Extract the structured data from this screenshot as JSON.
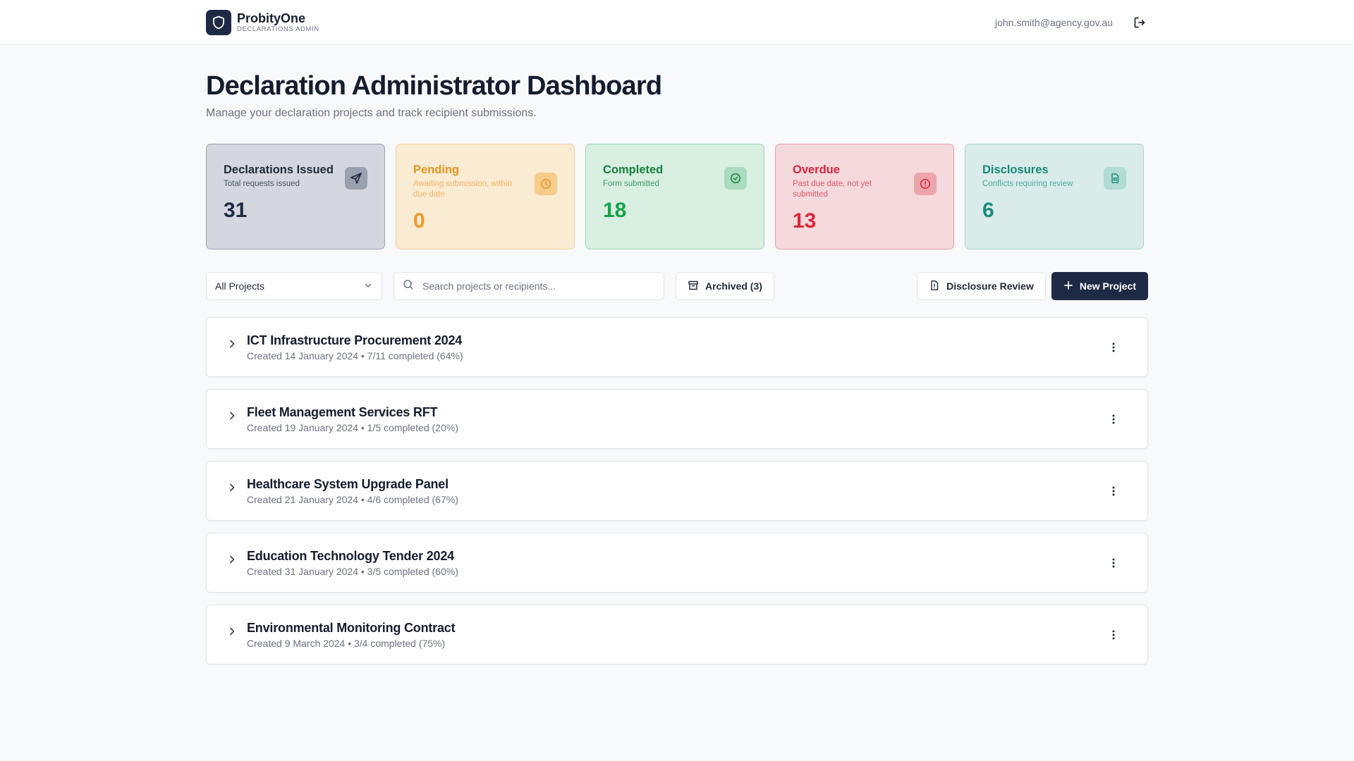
{
  "header": {
    "brand_name": "ProbityOne",
    "brand_sub": "DECLARATIONS ADMIN",
    "user_email": "john.smith@agency.gov.au",
    "logo_icon": "shield-icon",
    "logout_icon": "logout-icon"
  },
  "page": {
    "title": "Declaration Administrator Dashboard",
    "subtitle": "Manage your declaration projects and track recipient submissions."
  },
  "stats": [
    {
      "title": "Declarations Issued",
      "desc": "Total requests issued",
      "value": "31",
      "icon": "send-icon",
      "color": "#1f2a44"
    },
    {
      "title": "Pending",
      "desc": "Awaiting submission, within due date",
      "value": "0",
      "icon": "clock-icon",
      "color": "#f0962b"
    },
    {
      "title": "Completed",
      "desc": "Form submitted",
      "value": "18",
      "icon": "check-circle-icon",
      "color": "#16a34a"
    },
    {
      "title": "Overdue",
      "desc": "Past due date, not yet submitted",
      "value": "13",
      "icon": "alert-circle-icon",
      "color": "#dc2638"
    },
    {
      "title": "Disclosures",
      "desc": "Conflicts requiring review",
      "value": "6",
      "icon": "file-icon",
      "color": "#198c7c"
    }
  ],
  "toolbar": {
    "project_filter": "All Projects",
    "search_placeholder": "Search projects or recipients...",
    "archived_label": "Archived (3)",
    "disclosure_review_label": "Disclosure Review",
    "new_project_label": "New Project"
  },
  "projects": [
    {
      "name": "ICT Infrastructure Procurement 2024",
      "meta": "Created 14 January 2024 • 7/11 completed (64%)"
    },
    {
      "name": "Fleet Management Services RFT",
      "meta": "Created 19 January 2024 • 1/5 completed (20%)"
    },
    {
      "name": "Healthcare System Upgrade Panel",
      "meta": "Created 21 January 2024 • 4/6 completed (67%)"
    },
    {
      "name": "Education Technology Tender 2024",
      "meta": "Created 31 January 2024 • 3/5 completed (60%)"
    },
    {
      "name": "Environmental Monitoring Contract",
      "meta": "Created 9 March 2024 • 3/4 completed (75%)"
    }
  ]
}
